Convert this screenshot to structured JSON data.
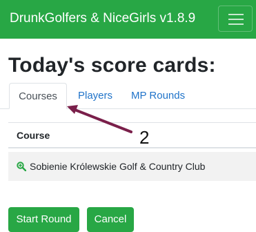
{
  "app": {
    "title": "DrunkGolfers & NiceGirls v1.8.9"
  },
  "page": {
    "heading": "Today's score cards:"
  },
  "tabs": [
    {
      "label": "Courses",
      "active": true
    },
    {
      "label": "Players",
      "active": false
    },
    {
      "label": "MP Rounds",
      "active": false
    }
  ],
  "table": {
    "header": "Course",
    "rows": [
      {
        "name": "Sobienie Królewskie Golf & Country Club",
        "icon": "zoom-in-icon"
      }
    ]
  },
  "buttons": {
    "start": "Start Round",
    "cancel": "Cancel"
  },
  "annotation": {
    "label": "2",
    "color": "#7a1f4a"
  },
  "colors": {
    "brand": "#28a745",
    "link": "#1f73c9"
  }
}
